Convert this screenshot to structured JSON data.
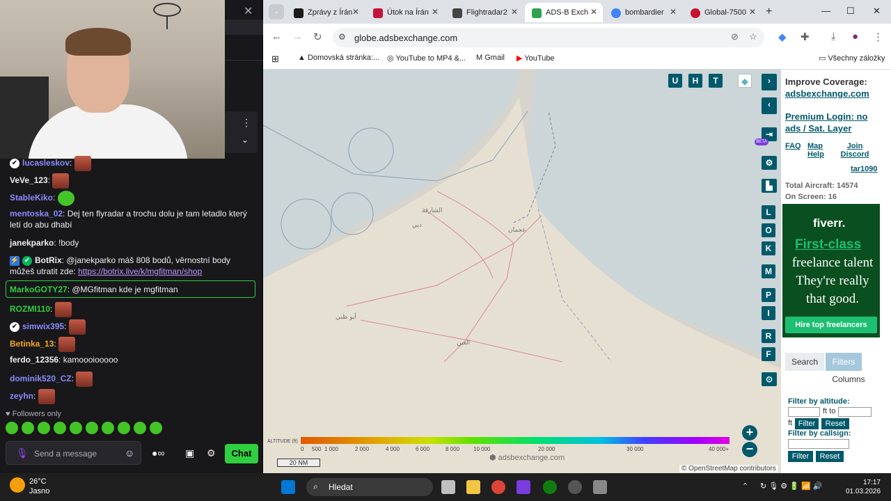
{
  "stream": {
    "chat_messages": [
      {
        "user": "lucasleskov",
        "text": "",
        "color": "#8a8cff"
      },
      {
        "user": "VeVe_123",
        "text": "",
        "color": "#efeff1"
      },
      {
        "user": "StableKiko",
        "text": "",
        "color": "#8a8cff"
      },
      {
        "user": "mentoska_02",
        "text": "Dej ten flyradar a trochu dolu je tam letadlo který letí do abu dhabí",
        "color": "#8a8cff"
      },
      {
        "user": "janekparko",
        "text": "!body",
        "color": "#efeff1"
      },
      {
        "user": "BotRix",
        "text": "@janekparko máš 808 bodů, věrnostní body můžeš utratit zde:",
        "color": "#efeff1"
      },
      {
        "user": "MarkoGOTY27",
        "text": "@MGfitman kde je mgfitman",
        "color": "#2fcf3f"
      },
      {
        "user": "ROZMI110",
        "text": "",
        "color": "#2fcf3f"
      },
      {
        "user": "simwix395",
        "text": "",
        "color": "#8a8cff"
      },
      {
        "user": "Betinka_13",
        "text": "",
        "color": "#f5a623"
      },
      {
        "user": "ferdo_12356",
        "text": "kamoooiooooo",
        "color": "#efeff1"
      },
      {
        "user": "dominik520_CZ",
        "text": "",
        "color": "#8a8cff"
      },
      {
        "user": "zeyhn",
        "text": "",
        "color": "#8a8cff"
      }
    ],
    "botrix_link": "https://botrix.live/k/mgfitman/shop",
    "followers_only": "Followers only",
    "chat_placeholder": "Send a message",
    "chat_button": "Chat"
  },
  "browser": {
    "tabs": [
      {
        "label": "Zprávy z Írán",
        "icon_color": "#1a1a1a"
      },
      {
        "label": "Útok na Írán",
        "icon_color": "#c4123a"
      },
      {
        "label": "Flightradar2",
        "icon_color": "#444444"
      },
      {
        "label": "ADS-B Exch",
        "icon_color": "#2ea44f",
        "active": true
      },
      {
        "label": "bombardier",
        "icon_color": "#4285f4"
      },
      {
        "label": "Global-7500",
        "icon_color": "#c8102e"
      }
    ],
    "url": "globe.adsbexchange.com",
    "bookmarks": [
      "Domovská stránka:...",
      "YouTube to MP4 &...",
      "Gmail",
      "YouTube"
    ],
    "all_bookmarks": "Všechny záložky"
  },
  "map": {
    "top_buttons": [
      "U",
      "H",
      "T"
    ],
    "side_buttons": [
      "L",
      "O",
      "K",
      "M",
      "P",
      "I",
      "R",
      "F"
    ],
    "beta": "BETA",
    "altitude_label": "ALTITUDE (ft)",
    "altitude_ticks": [
      "0",
      "500",
      "1 000",
      "2 000",
      "4 000",
      "6 000",
      "8 000",
      "10 000",
      "20 000",
      "30 000",
      "40 000+"
    ],
    "scale": "20 NM",
    "watermark": "adsbexchange.com",
    "attribution": "© OpenStreetMap contributors",
    "place_labels": [
      "الشارقة",
      "دبي",
      "أبو ظبي",
      "العين",
      "عجمان"
    ]
  },
  "sidebar": {
    "improve": "Improve Coverage:",
    "improve_link": "adsbexchange.com",
    "premium": "Premium Login: no ads / Sat. Layer",
    "faq": "FAQ",
    "map_help": "Map Help",
    "join_discord": "Join Discord",
    "user": "tar1090",
    "total_aircraft": "Total Aircraft: 14574",
    "on_screen": "On Screen: 16",
    "ad": {
      "brand": "fiverr.",
      "headline": "First-class",
      "body": "freelance talent They're really that good.",
      "cta": "Hire top freelancers"
    },
    "tabs": [
      "Search",
      "Filters",
      "Columns"
    ],
    "filter_altitude": "Filter by altitude:",
    "ft_to": "ft to",
    "ft": "ft",
    "filter": "Filter",
    "reset": "Reset",
    "filter_callsign": "Filter by callsign:"
  },
  "taskbar": {
    "temp": "26°C",
    "weather": "Jasno",
    "search": "Hledat",
    "time": "17:17",
    "date": "01.03.2026"
  }
}
